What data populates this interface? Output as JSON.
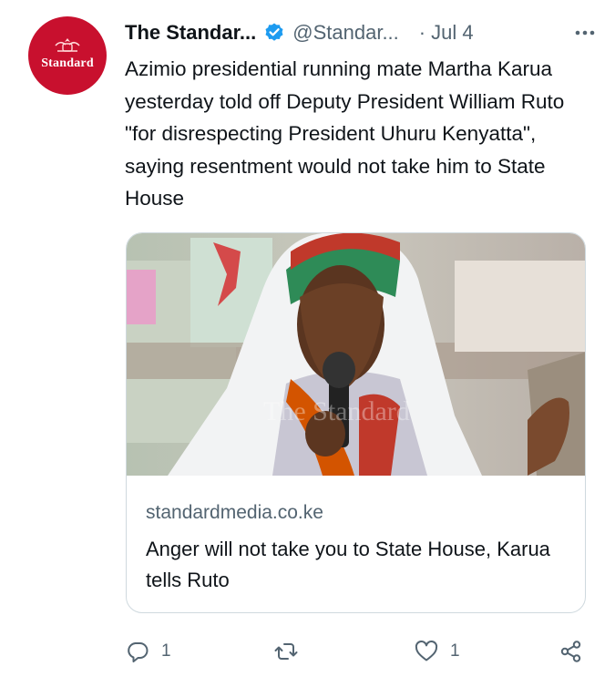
{
  "account": {
    "name": "The Standar...",
    "handle": "@Standar...",
    "date": "Jul 4",
    "avatar_text": "Standard",
    "verified": true,
    "brand_color": "#c8102e",
    "verified_color": "#1d9bf0"
  },
  "tweet": {
    "text": "Azimio presidential running mate Martha Karua yesterday told off Deputy President William Ruto \"for disrespecting President Uhuru Kenyatta\", saying resentment would not take him to State House"
  },
  "link_card": {
    "domain": "standardmedia.co.ke",
    "title": "Anger will not take you to State House, Karua tells Ruto",
    "image_watermark": "The Standard"
  },
  "actions": {
    "reply": {
      "icon": "reply-icon",
      "count": "1"
    },
    "retweet": {
      "icon": "retweet-icon",
      "count": ""
    },
    "like": {
      "icon": "heart-icon",
      "count": "1"
    },
    "share": {
      "icon": "share-icon"
    }
  },
  "dot_separator": "·"
}
